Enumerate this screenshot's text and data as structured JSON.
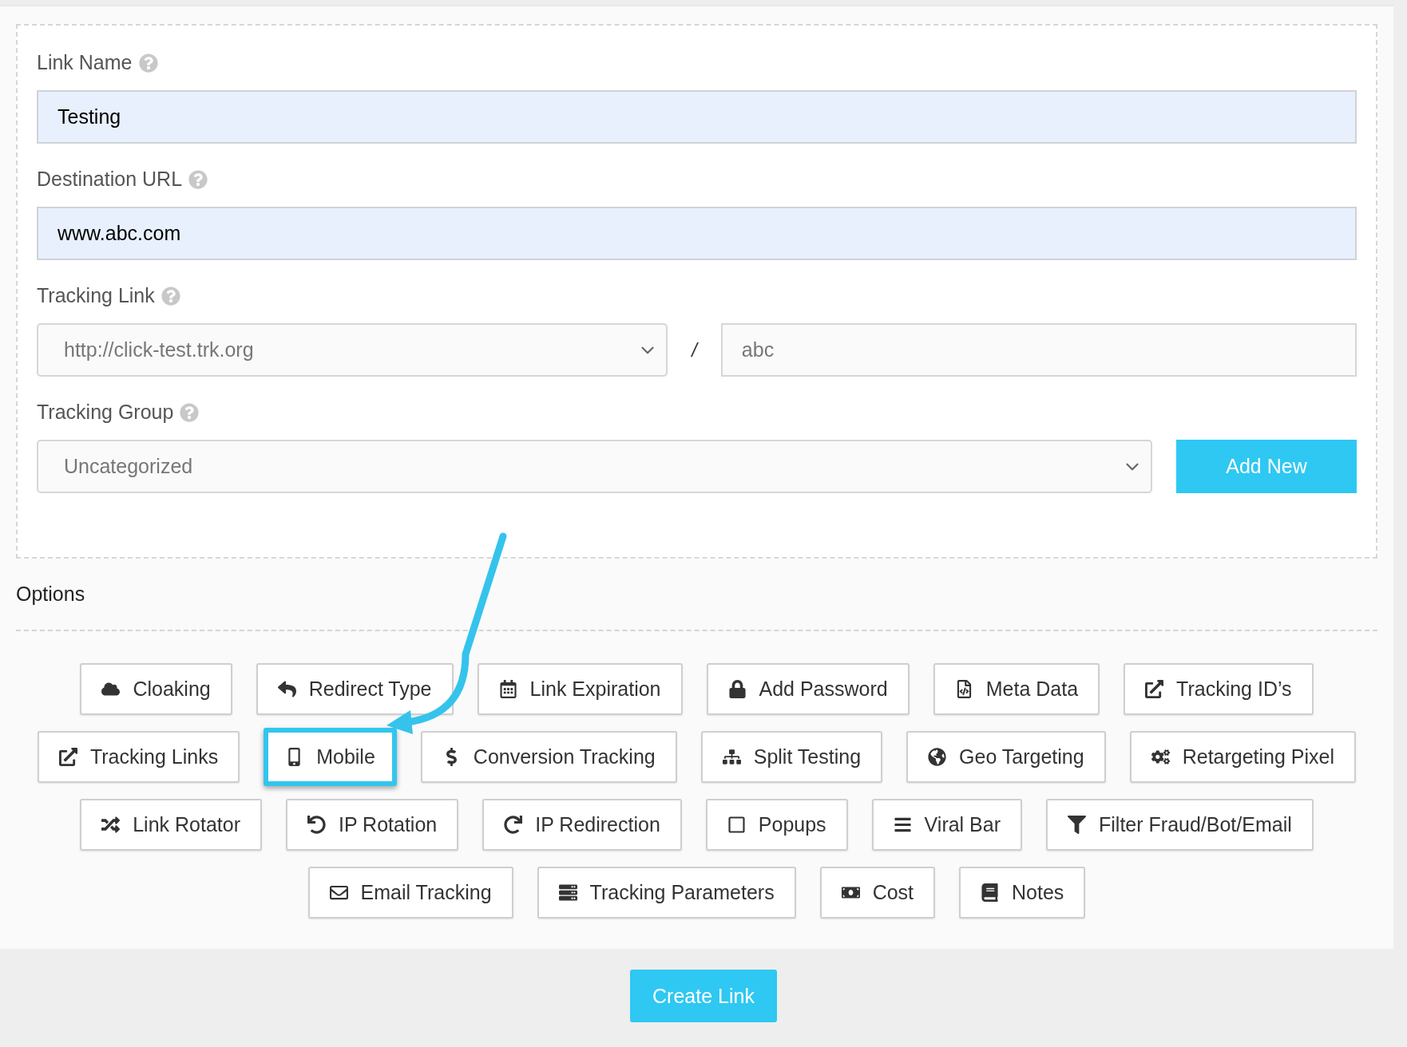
{
  "fields": [
    {
      "kind": "input",
      "label": "Link Name",
      "value": "Testing"
    },
    {
      "kind": "input",
      "label": "Destination URL",
      "value": "www.abc.com"
    },
    {
      "kind": "split",
      "label": "Tracking Link",
      "select": "http://click-test.trk.org",
      "separator": "/",
      "placeholder": "abc"
    },
    {
      "kind": "select_button",
      "label": "Tracking Group",
      "select": "Uncategorized",
      "button": "Add New"
    }
  ],
  "options": {
    "title": "Options",
    "rows": [
      {
        "buttons": [
          {
            "label": "Cloaking",
            "highlighted": false
          },
          {
            "label": "Redirect Type",
            "highlighted": false
          },
          {
            "label": "Link Expiration",
            "highlighted": false
          },
          {
            "label": "Add Password",
            "highlighted": false
          },
          {
            "label": "Meta Data",
            "highlighted": false
          },
          {
            "label": "Tracking ID’s",
            "highlighted": false
          }
        ]
      },
      {
        "buttons": [
          {
            "label": "Tracking Links",
            "highlighted": false
          },
          {
            "label": "Mobile",
            "highlighted": true
          },
          {
            "label": "Conversion Tracking",
            "highlighted": false
          },
          {
            "label": "Split Testing",
            "highlighted": false
          },
          {
            "label": "Geo Targeting",
            "highlighted": false
          },
          {
            "label": "Retargeting Pixel",
            "highlighted": false
          }
        ]
      },
      {
        "buttons": [
          {
            "label": "Link Rotator",
            "highlighted": false
          },
          {
            "label": "IP Rotation",
            "highlighted": false
          },
          {
            "label": "IP Redirection",
            "highlighted": false
          },
          {
            "label": "Popups",
            "highlighted": false
          },
          {
            "label": "Viral Bar",
            "highlighted": false
          },
          {
            "label": "Filter Fraud/Bot/Email",
            "highlighted": false
          }
        ]
      },
      {
        "buttons": [
          {
            "label": "Email Tracking",
            "highlighted": false
          },
          {
            "label": "Tracking Parameters",
            "highlighted": false
          },
          {
            "label": "Cost",
            "highlighted": false
          },
          {
            "label": "Notes",
            "highlighted": false
          }
        ]
      }
    ]
  },
  "submit": "Create Link"
}
